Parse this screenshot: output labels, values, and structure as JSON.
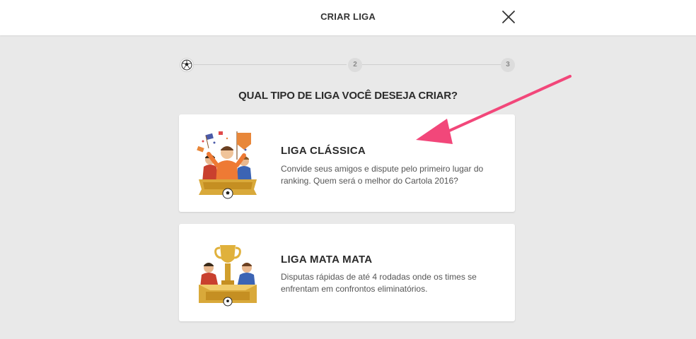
{
  "header": {
    "title": "CRIAR LIGA"
  },
  "stepper": {
    "steps": [
      "",
      "2",
      "3"
    ],
    "active_step": 1
  },
  "question": "QUAL TIPO DE LIGA VOCÊ DESEJA CRIAR?",
  "options": [
    {
      "title": "LIGA CLÁSSICA",
      "description": "Convide seus amigos e dispute pelo primeiro lugar do ranking. Quem será o melhor do Cartola 2016?",
      "icon": "players-celebration-icon"
    },
    {
      "title": "LIGA MATA MATA",
      "description": "Disputas rápidas de até 4 rodadas onde os times se enfrentam em confrontos eliminatórios.",
      "icon": "trophy-players-icon"
    }
  ],
  "colors": {
    "background": "#e9e9e9",
    "card": "#ffffff",
    "annotation_arrow": "#f2477a",
    "accent_orange": "#e8873a",
    "gold": "#d9a93a"
  }
}
